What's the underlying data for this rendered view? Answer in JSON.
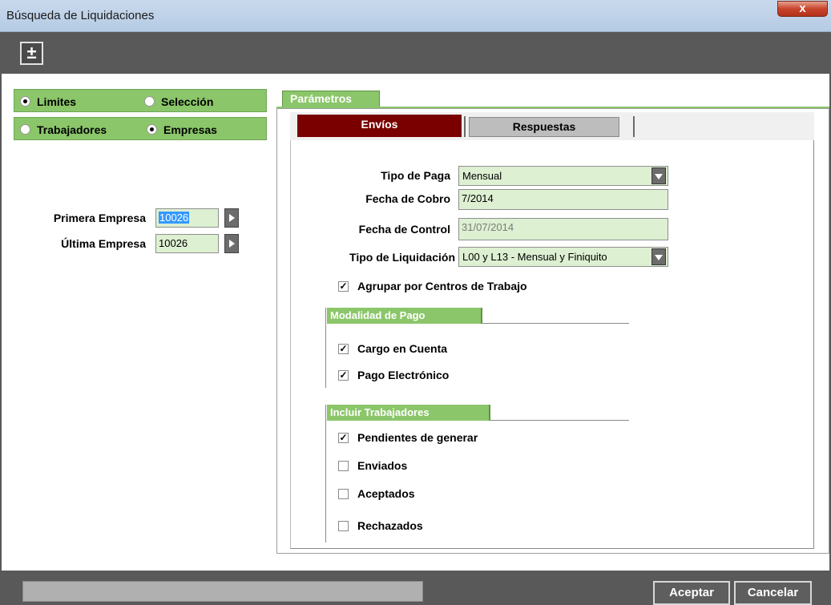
{
  "window": {
    "title": "Búsqueda de Liquidaciones",
    "close_glyph": "x"
  },
  "toolbar": {
    "toggle_glyph": "±"
  },
  "filter": {
    "mode_options": [
      {
        "label": "Limites",
        "selected": true
      },
      {
        "label": "Selección",
        "selected": false
      }
    ],
    "scope_options": [
      {
        "label": "Trabajadores",
        "selected": false
      },
      {
        "label": "Empresas",
        "selected": true
      }
    ],
    "first_company": {
      "label": "Primera Empresa",
      "value": "10026"
    },
    "last_company": {
      "label": "Última Empresa",
      "value": "10026"
    }
  },
  "params": {
    "tab_label": "Parámetros",
    "subtabs": [
      {
        "label": "Envíos",
        "active": true
      },
      {
        "label": "Respuestas",
        "active": false
      }
    ],
    "tipo_paga": {
      "label": "Tipo de Paga",
      "value": "Mensual"
    },
    "fecha_cobro": {
      "label": "Fecha de Cobro",
      "value": "7/2014"
    },
    "fecha_control": {
      "label": "Fecha de Control",
      "value": "31/07/2014"
    },
    "tipo_liquidacion": {
      "label": "Tipo de Liquidación",
      "value": "L00 y L13 - Mensual y Finiquito"
    },
    "agrupar": {
      "label": "Agrupar por Centros de Trabajo",
      "checked": true
    },
    "modalidad": {
      "title": "Modalidad de Pago",
      "items": [
        {
          "label": "Cargo en Cuenta",
          "checked": true
        },
        {
          "label": "Pago Electrónico",
          "checked": true
        }
      ]
    },
    "incluir": {
      "title": "Incluir Trabajadores",
      "items": [
        {
          "label": "Pendientes de generar",
          "checked": true
        },
        {
          "label": "Enviados",
          "checked": false
        },
        {
          "label": "Aceptados",
          "checked": false
        },
        {
          "label": "Rechazados",
          "checked": false
        }
      ]
    }
  },
  "footer": {
    "status_text": "",
    "accept_label": "Aceptar",
    "cancel_label": "Cancelar"
  },
  "colors": {
    "accent_green": "#8bc66a",
    "tab_active": "#7a0000",
    "field_bg": "#ddf0d2",
    "chrome_gray": "#595959"
  }
}
